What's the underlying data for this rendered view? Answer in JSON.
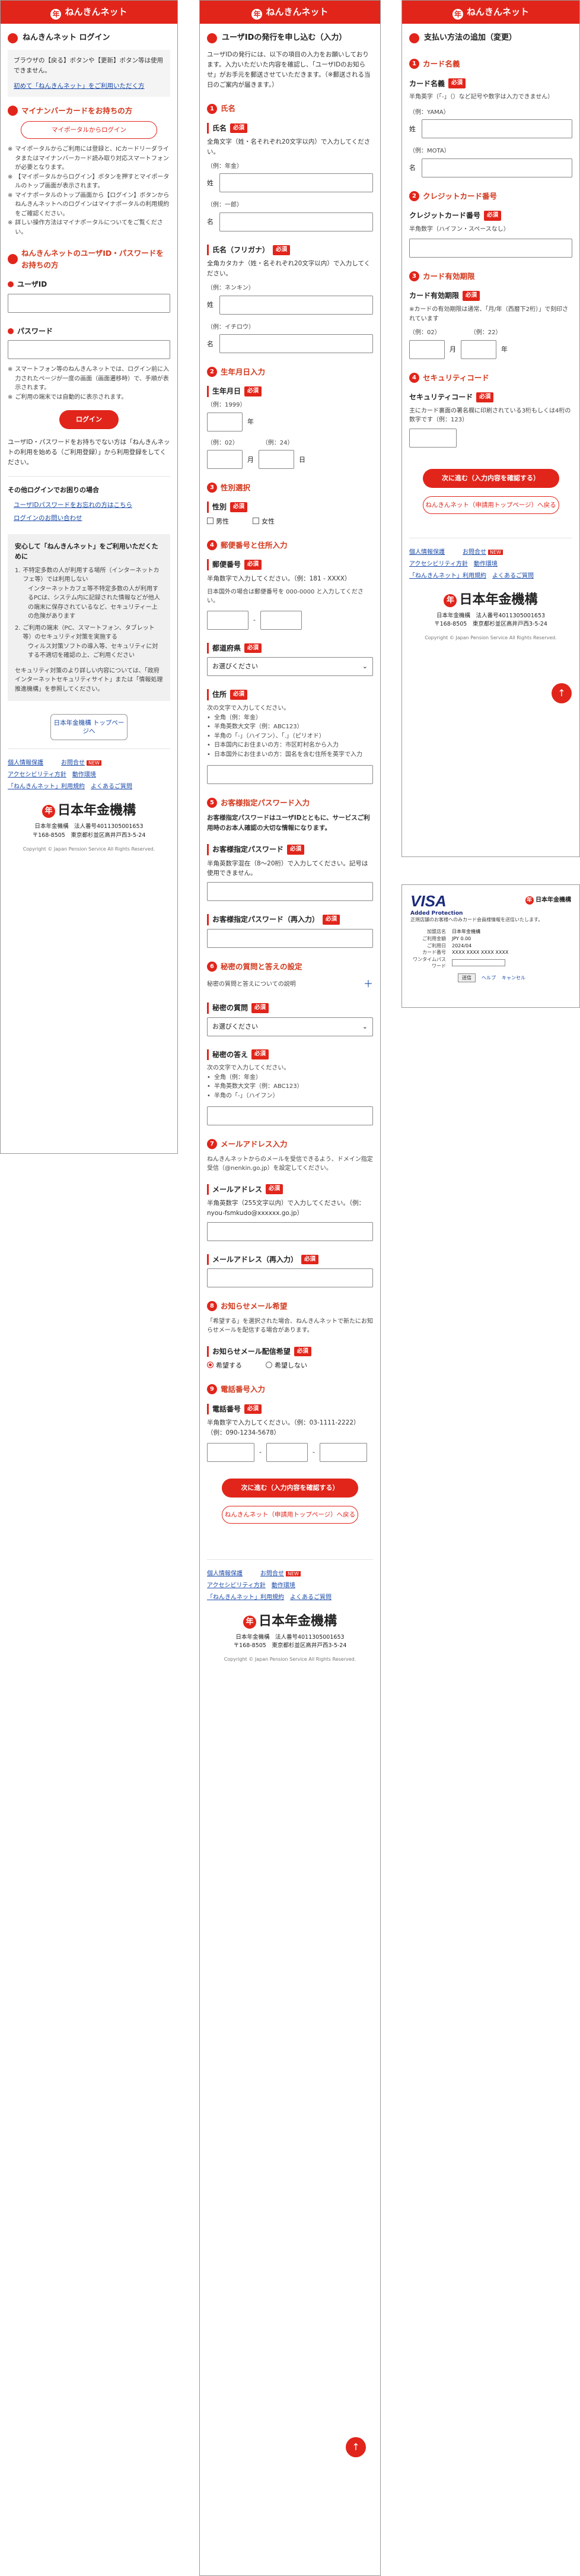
{
  "brand": {
    "header_title": "ねんきんネット",
    "logo_glyph": "年",
    "accent": "#e1251b"
  },
  "p1": {
    "title": "ねんきんネット ログイン",
    "intro": "ブラウザの【戻る】ボタンや【更新】ボタン等は使用できません。",
    "intro_link": "初めて「ねんきんネット」をご利用いただく方",
    "mynumber_title": "マイナンバーカードをお持ちの方",
    "mynumber_btn": "マイポータルからログイン",
    "mynumber_notes": [
      "マイポータルからご利用には登録と、ICカードリーダライタまたはマイナンバーカード読み取り対応スマートフォンが必要となります。",
      "【マイポータルからログイン】ボタンを押すとマイポータルのトップ画面が表示されます。",
      "マイナポータルのトップ画面から【ログイン】ボタンからねんきんネットへのログインはマイナポータルの利用規約をご確認ください。",
      "詳しい操作方法はマイナポータルについてをご覧ください。"
    ],
    "login_title": "ねんきんネットのユーザID・パスワードをお持ちの方",
    "userid_label": "ユーザID",
    "password_label": "パスワード",
    "pw_notes": [
      "スマートフォン等のねんきんネットでは、ログイン前に入力されたページが一度の画面（画面遷移時）で、手順が表示されます。",
      "ご利用の端末では自動的に表示されます。"
    ],
    "login_btn": "ログイン",
    "forgot_text": "ユーザID・パスワードをお持ちでない方は「ねんきんネットの利用を始める（ご利用登録）」から利用登録をしてください。",
    "other_login_title": "その他ログインでお困りの場合",
    "other_links": [
      "ユーザIDパスワードをお忘れの方はこちら",
      "ログインのお問い合わせ"
    ],
    "safety_title": "安心して「ねんきんネット」をご利用いただくために",
    "safety_items": [
      "不特定多数の人が利用する場所（インターネットカフェ等）では利用しない",
      "インターネットカフェ等不特定多数の人が利用するPCは、システム内に記録された情報などが他人の端末に保存されているなど、セキュリティー上の危険があります",
      "ご利用の端末（PC、スマートフォン、タブレット等）のセキュリティ対策を実施する",
      "ウィルス対策ソフトの導入等、セキュリティに対する不適切を確認の上、ご利用ください"
    ],
    "safety_more": "セキュリティ対策のより詳しい内容については、「政府インターネットセキュリティサイト」または「情報処理推進機構」を参照してください。",
    "top_btn": "日本年金機構 トップページへ"
  },
  "p2": {
    "title": "ユーザIDの発行を申し込む（入力）",
    "intro": "ユーザIDの発行には、以下の項目の入力をお願いしております。入力いただいた内容を確認し、「ユーザIDのお知らせ」がお手元を郵送させていただきます。（※郵送される当日のご案内が届きます。）",
    "sections": {
      "name": "氏名",
      "birth": "生年月日入力",
      "gender": "性別選択",
      "address": "郵便番号と住所入力",
      "password": "お客様指定パスワード入力",
      "secret": "秘密の質問と答えの設定",
      "mail": "メールアドレス入力",
      "mailpref": "お知らせメール希望",
      "phone": "電話番号入力"
    },
    "name_kanji_label": "氏名",
    "name_kanji_note": "全角文字（姓・名それぞれ20文字以内）で入力してください。",
    "ex_sei": "（例：年金）",
    "ex_mei": "（例：一郎）",
    "sei": "姓",
    "mei": "名",
    "name_kana_label": "氏名（フリガナ）",
    "name_kana_note": "全角カタカナ（姓・名それぞれ20文字以内）で入力してください。",
    "ex_kana_sei": "（例：ネンキン）",
    "ex_kana_mei": "（例：イチロウ）",
    "birth_label": "生年月日",
    "ex_year": "（例：1999）",
    "year": "年",
    "ex_month": "（例：02）",
    "ex_day": "（例：24）",
    "month": "月",
    "day": "日",
    "gender_label": "性別",
    "male": "男性",
    "female": "女性",
    "postal_label": "郵便番号",
    "postal_note": "半角数字で入力してください。（例：181 - XXXX）",
    "postal_ex": "日本国外の場合は郵便番号を 000-0000 と入力してください。",
    "pref_label": "都道府県",
    "pref_select": "お選びください",
    "addr_label": "住所",
    "addr_notes": [
      "次の文字で入力してください。",
      "全角（例：年金）",
      "半角英数大文字（例：ABC123）",
      "半角の「-」（ハイフン）、「.」（ピリオド）",
      "日本国内にお住まいの方：市区町村名から入力",
      "日本国外にお住まいの方：国名を含む住所を英字で入力"
    ],
    "pw_intro": "お客様指定パスワードはユーザIDとともに、サービスご利用時のお本人確認の大切な情報になります。",
    "pw_label": "お客様指定パスワード",
    "pw_note": "半角英数字混在（8～20桁）で入力してください。記号は使用できません。",
    "pw2_label": "お客様指定パスワード（再入力）",
    "secret_help": "秘密の質問と答えについての説明",
    "secret_q_label": "秘密の質問",
    "secret_q_select": "お選びください",
    "secret_a_label": "秘密の答え",
    "secret_a_notes": [
      "次の文字で入力してください。",
      "全角（例：年金）",
      "半角英数大文字（例：ABC123）",
      "半角の「-」（ハイフン）"
    ],
    "mail_notes": "ねんきんネットからのメールを受信できるよう、ドメイン指定受信（@nenkin.go.jp）を設定してください。",
    "mail_label": "メールアドレス",
    "mail_ex": "半角英数字（255文字以内）で入力してください。（例：nyou-fsmkudo@xxxxxx.go.jp）",
    "mail2_label": "メールアドレス（再入力）",
    "mailpref_note": "「希望する」を選択された場合、ねんきんネットで新たにお知らせメールを配信する場合があります。",
    "mailpref_label": "お知らせメール配信希望",
    "mail_yes": "希望する",
    "mail_no": "希望しない",
    "phone_label": "電話番号",
    "phone_ex": "半角数字で入力してください。（例：03-1111-2222）（例：090-1234-5678）",
    "next_btn": "次に進む（入力内容を確認する）",
    "top_btn": "ねんきんネット（申請用トップページ）へ戻る"
  },
  "p3": {
    "title": "支払い方法の追加（変更）",
    "card_name_sec": "カード名義",
    "card_name_label": "カード名義",
    "card_name_note": "半角英字（「-」（）など記号や数字は入力できません）",
    "ex_sei": "（例：YAMA）",
    "ex_mei": "（例：MOTA）",
    "sei": "姓",
    "mei": "名",
    "card_no_sec": "クレジットカード番号",
    "card_no_label": "クレジットカード番号",
    "card_no_note": "半角数字（ハイフン・スペースなし）",
    "exp_sec": "カード有効期限",
    "exp_label": "カード有効期限",
    "exp_note": "※カードの有効期限は通常、「月/年（西暦下2桁）」で刻印されています",
    "ex_month": "（例：02）",
    "ex_year": "（例：22）",
    "month": "月",
    "year": "年",
    "sec_sec": "セキュリティコード",
    "sec_label": "セキュリティコード",
    "sec_note": "主にカード裏面の署名欄に印刷されている3桁もしくは4桁の数字です（例：123）",
    "next_btn": "次に進む（入力内容を確認する）",
    "top_btn": "ねんきんネット（申請用トップページ）へ戻る"
  },
  "p4": {
    "visa": "VISA",
    "secure": "Added Protection",
    "msg": "正規店舗のお客様へのみカード会員様情報を送信いたします。",
    "rows": [
      {
        "k": "加盟店名",
        "v": "日本年金機構"
      },
      {
        "k": "ご利用金額",
        "v": "JPY 0.00"
      },
      {
        "k": "ご利用日",
        "v": "2024/04"
      },
      {
        "k": "カード番号",
        "v": "XXXX XXXX XXXX XXXX"
      },
      {
        "k": "ワンタイムパスワード",
        "v": ""
      }
    ],
    "submit": "送信",
    "help": "ヘルプ",
    "cancel": "キャンセル"
  },
  "footer": {
    "links": [
      "個人情報保護",
      "お問合せ",
      "アクセシビリティ方針",
      "動作環境",
      "「ねんきんネット」利用規約",
      "よくあるご質問"
    ],
    "new_tag": "NEW",
    "org": "日本年金機構",
    "corp": "日本年金機構　法人番号4011305001653",
    "address": "〒168-8505　東京都杉並区高井戸西3-5-24",
    "copyright": "Copyright © Japan Pension Service All Rights Reserved."
  }
}
